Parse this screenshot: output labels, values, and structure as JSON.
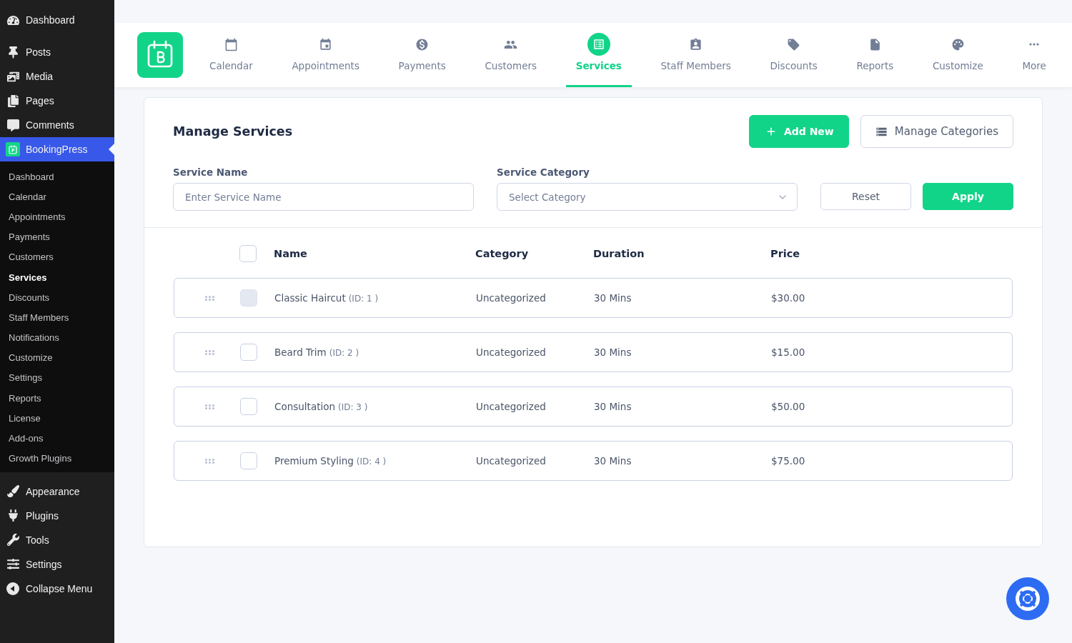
{
  "sidebar": {
    "menu": [
      {
        "label": "Dashboard",
        "selected": false
      },
      {
        "label": "Posts",
        "selected": false
      },
      {
        "label": "Media",
        "selected": false
      },
      {
        "label": "Pages",
        "selected": false
      },
      {
        "label": "Comments",
        "selected": false
      },
      {
        "label": "BookingPress",
        "selected": true,
        "children": [
          {
            "label": "Dashboard",
            "selected": false
          },
          {
            "label": "Calendar",
            "selected": false
          },
          {
            "label": "Appointments",
            "selected": false
          },
          {
            "label": "Payments",
            "selected": false
          },
          {
            "label": "Customers",
            "selected": false
          },
          {
            "label": "Services",
            "selected": true
          },
          {
            "label": "Discounts",
            "selected": false
          },
          {
            "label": "Staff Members",
            "selected": false
          },
          {
            "label": "Notifications",
            "selected": false
          },
          {
            "label": "Customize",
            "selected": false
          },
          {
            "label": "Settings",
            "selected": false
          },
          {
            "label": "Reports",
            "selected": false
          },
          {
            "label": "License",
            "selected": false
          },
          {
            "label": "Add-ons",
            "selected": false
          },
          {
            "label": "Growth Plugins",
            "selected": false
          }
        ]
      },
      {
        "label": "Appearance",
        "selected": false
      },
      {
        "label": "Plugins",
        "selected": false
      },
      {
        "label": "Tools",
        "selected": false
      },
      {
        "label": "Settings",
        "selected": false
      }
    ],
    "collapse": {
      "label": "Collapse Menu"
    }
  },
  "app_nav": {
    "tabs": [
      {
        "label": "Calendar",
        "selected": false
      },
      {
        "label": "Appointments",
        "selected": false
      },
      {
        "label": "Payments",
        "selected": false
      },
      {
        "label": "Customers",
        "selected": false
      },
      {
        "label": "Services",
        "selected": true
      },
      {
        "label": "Staff Members",
        "selected": false
      },
      {
        "label": "Discounts",
        "selected": false
      },
      {
        "label": "Reports",
        "selected": false
      },
      {
        "label": "Customize",
        "selected": false
      },
      {
        "label": "More",
        "selected": false
      }
    ]
  },
  "services_panel": {
    "title": "Manage Services",
    "actions": [
      {
        "label": "Add New",
        "kind": "primary"
      },
      {
        "label": "Manage Categories",
        "kind": "secondary"
      }
    ],
    "filters": {
      "fields": [
        {
          "label": "Service Name",
          "placeholder": "Enter Service Name",
          "kind": "text"
        },
        {
          "label": "Service Category",
          "placeholder": "Select Category",
          "kind": "select"
        }
      ],
      "buttons": [
        {
          "label": "Reset",
          "kind": "secondary"
        },
        {
          "label": "Apply",
          "kind": "primary"
        }
      ]
    },
    "table": {
      "select_all": {
        "checked": false
      },
      "columns": [
        "Name",
        "Category",
        "Duration",
        "Price"
      ],
      "rows": [
        {
          "name": "Classic Haircut",
          "id": "(ID: 1 )",
          "category": "Uncategorized",
          "duration": "30 Mins",
          "price": "$30.00",
          "checked": false,
          "disabled": true
        },
        {
          "name": "Beard Trim",
          "id": "(ID: 2 )",
          "category": "Uncategorized",
          "duration": "30 Mins",
          "price": "$15.00",
          "checked": false,
          "disabled": false
        },
        {
          "name": "Consultation",
          "id": "(ID: 3 )",
          "category": "Uncategorized",
          "duration": "30 Mins",
          "price": "$50.00",
          "checked": false,
          "disabled": false
        },
        {
          "name": "Premium Styling",
          "id": "(ID: 4 )",
          "category": "Uncategorized",
          "duration": "30 Mins",
          "price": "$75.00",
          "checked": false,
          "disabled": false
        }
      ]
    }
  }
}
